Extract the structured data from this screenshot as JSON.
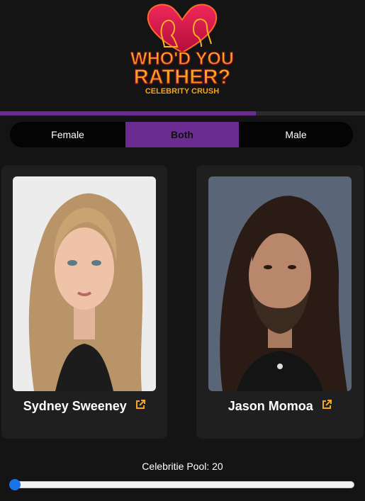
{
  "logo": {
    "line1": "WHO'D YOU",
    "line2": "RATHER?",
    "line3": "CELEBRITY CRUSH",
    "colors": {
      "heart": "#e8164d",
      "text": "#f6a21a",
      "subtext": "#f6a21a"
    }
  },
  "progress": {
    "fraction": 0.7,
    "color": "#6b2c91"
  },
  "filter": {
    "options": [
      {
        "label": "Female",
        "active": false
      },
      {
        "label": "Both",
        "active": true
      },
      {
        "label": "Male",
        "active": false
      }
    ]
  },
  "cards": [
    {
      "name": "Sydney Sweeney",
      "link_icon": "external-link-icon"
    },
    {
      "name": "Jason Momoa",
      "link_icon": "external-link-icon"
    }
  ],
  "pool": {
    "label": "Celebritie Pool: 20",
    "value": 20,
    "slider_fraction": 0.0
  },
  "colors": {
    "accent": "#6b2c91",
    "link": "#f5a623",
    "slider_thumb": "#1a73e8",
    "card": "#1f1f1f",
    "background": "#141414"
  }
}
